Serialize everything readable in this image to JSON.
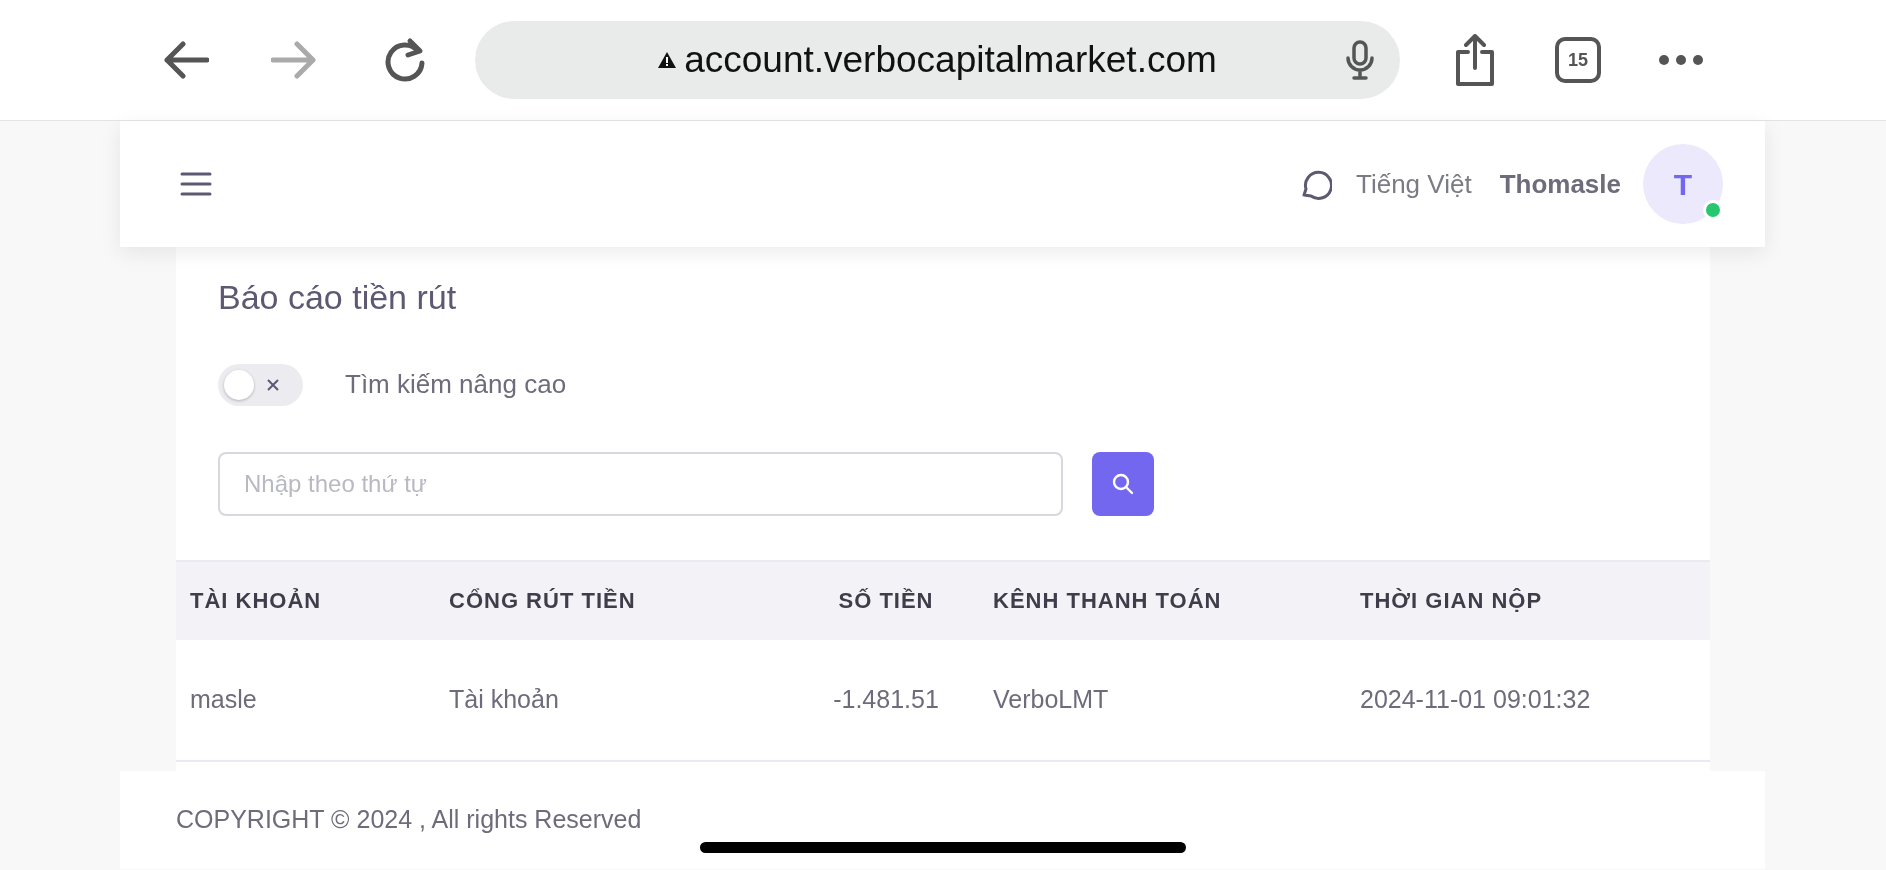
{
  "browser": {
    "url": "account.verbocapitalmarket.com",
    "tab_count": "15"
  },
  "header": {
    "language": "Tiếng Việt",
    "username": "Thomasle",
    "avatar_initial": "T",
    "online": true
  },
  "report": {
    "title": "Báo cáo tiền rút",
    "advanced_search": {
      "label": "Tìm kiếm nâng cao",
      "on": false
    },
    "search": {
      "placeholder": "Nhập theo thứ tự"
    }
  },
  "table": {
    "columns": [
      "TÀI KHOẢN",
      "CỔNG RÚT TIỀN",
      "SỐ TIỀN",
      "KÊNH THANH TOÁN",
      "THỜI GIAN NỘP"
    ],
    "rows": [
      [
        "masle",
        "Tài khoản",
        "-1.481.51",
        "VerboLMT",
        "2024-11-01 09:01:32"
      ]
    ]
  },
  "footer": {
    "copyright": "COPYRIGHT © 2024 , All rights Reserved"
  }
}
